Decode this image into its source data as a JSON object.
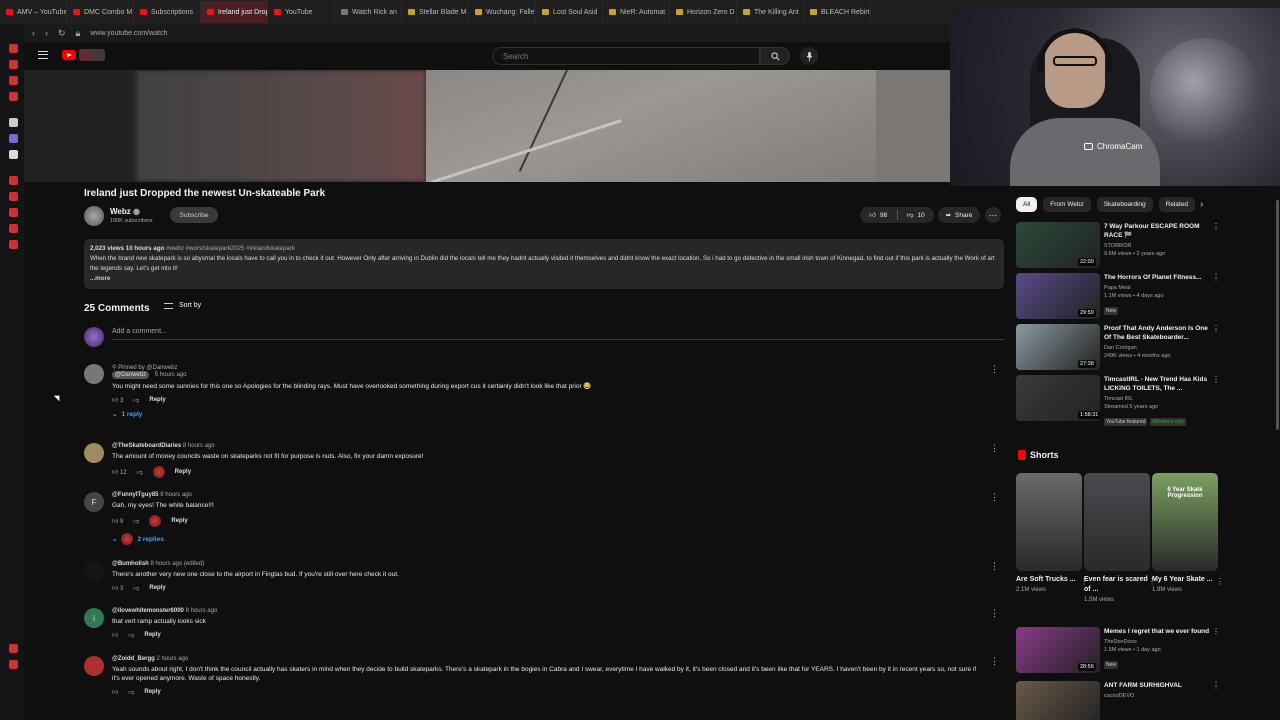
{
  "browser": {
    "tabs": [
      {
        "label": "AMV – YouTube",
        "fav": "red"
      },
      {
        "label": "DMC Combo M",
        "fav": "red"
      },
      {
        "label": "Subscriptions",
        "fav": "red"
      },
      {
        "label": "Ireland just Dropped",
        "fav": "red",
        "active": true
      },
      {
        "label": "YouTube",
        "fav": "red"
      },
      {
        "label": "Watch Rick an",
        "fav": "dark"
      },
      {
        "label": "Stellar Blade M",
        "fav": "gold"
      },
      {
        "label": "Wuchang: Falle",
        "fav": "gold"
      },
      {
        "label": "Lost Soul Asid",
        "fav": "gold"
      },
      {
        "label": "NieR: Automat",
        "fav": "gold"
      },
      {
        "label": "Horizon Zero D",
        "fav": "gold"
      },
      {
        "label": "The Killing Ant",
        "fav": "gold"
      },
      {
        "label": "BLEACH Rebirt",
        "fav": "gold"
      }
    ],
    "url": "www.youtube.com/watch"
  },
  "header": {
    "search_placeholder": "Search"
  },
  "webcam": {
    "label": "ChromaCam"
  },
  "video": {
    "title": "Ireland just Dropped the newest Un-skateable Park",
    "channel": "Webz",
    "subscribers": "190K subscribers",
    "subscribe_label": "Subscribe",
    "likes": "98",
    "dislikes": "10",
    "share_label": "Share",
    "description": {
      "meta": "2,023 views  10 hours ago",
      "tags": "#webz #worstskatepark2025 #irelandskatepark",
      "text": "When the brand new skatepark is so abysmal the locals have to call you in to check it out. However Only after arriving in Dublin did the locals tell me they hadnt actually visited it themselves and didnt know the exact location. So i had to go detective in the small irish town of Kinnegad, to find out if this park is actually the Work of art the legends say. Let's get into it!",
      "more": "...more"
    }
  },
  "comments": {
    "count_label": "25 Comments",
    "sort_label": "Sort by",
    "add_placeholder": "Add a comment...",
    "items": [
      {
        "pinned": "Pinned by @Danwebz",
        "author": "@Danwebz",
        "time": "5 hours ago",
        "text": "You might need some sunnies for this one so Apologies for the blinding rays. Must have overlooked something during export cus it certainly didn't look like that prior 😂",
        "likes": "3",
        "reply_label": "Reply",
        "replies": "1 reply",
        "avatar_color": "#777",
        "avatar_letter": ""
      },
      {
        "author": "@TheSkateboardDiaries",
        "time": "8 hours ago",
        "text": "The amount of money councils waste on skateparks not fit for purpose is nuts.  Also, fix your damn exposure!",
        "likes": "12",
        "reply_label": "Reply",
        "avatar_color": "#a08a60",
        "avatar_letter": ""
      },
      {
        "author": "@FunnyITguy85",
        "time": "8 hours ago",
        "text": "Gah, my eyes! The white balance!!!",
        "likes": "9",
        "reply_label": "Reply",
        "replies": "2 replies",
        "avatar_color": "#4a4545",
        "avatar_letter": "F"
      },
      {
        "author": "@Bumholish",
        "time": "8 hours ago (edited)",
        "text": "There's another very new one close to the airport in Finglas bud. If you're still over here check it out.",
        "likes": "3",
        "reply_label": "Reply",
        "avatar_color": "#151515",
        "avatar_letter": ""
      },
      {
        "author": "@ilovewhitemonster6000",
        "time": "8 hours ago",
        "text": "that vert ramp actually looks sick",
        "likes": "",
        "reply_label": "Reply",
        "avatar_color": "#2f7a55",
        "avatar_letter": "i"
      },
      {
        "author": "@Zoidd_Bergg",
        "time": "2 hours ago",
        "text": "Yeah sounds about right, I don't think the council actually has skaters in mind when they decide to build skateparks. There's a skatepark in the bogies in Cabra and I swear, everytime I have walked by it, it's been closed and it's been like that for YEARS. I haven't been by it in recent years so, not sure if it's ever opened anymore. Waste of space honestly.",
        "likes": "",
        "reply_label": "Reply",
        "avatar_color": "#b03030",
        "avatar_letter": ""
      }
    ]
  },
  "sidebar": {
    "chips": [
      "All",
      "From Webz",
      "Skateboarding",
      "Related"
    ],
    "recommended": [
      {
        "title": "7 Way Parkour ESCAPE ROOM RACE 🏁",
        "channel": "STORROR",
        "meta": "9.6M views • 2 years ago",
        "duration": "22:00",
        "color": "#2b4a3a",
        "badge": ""
      },
      {
        "title": "The Horrors Of Planet Fitness...",
        "channel": "Papa Meat",
        "meta": "1.1M views • 4 days ago",
        "duration": "29:59",
        "color": "#5a4a8a",
        "badge": "New"
      },
      {
        "title": "Proof That Andy Anderson Is One Of The Best Skateboarder...",
        "channel": "Dan Corrigan",
        "meta": "249K views • 4 months ago",
        "duration": "27:38",
        "color": "#8a9aa0",
        "badge": ""
      },
      {
        "title": "TimcastIRL - New Trend Has Kids LICKING TOILETS, The ...",
        "channel": "Timcast IRL",
        "meta": "Streamed 5 years ago",
        "duration": "1:58:31",
        "color": "#3a3a3a",
        "badge": "YouTube featured",
        "members": "Members only"
      }
    ],
    "shorts_label": "Shorts",
    "shorts": [
      {
        "title": "Are Soft Trucks ...",
        "views": "2.1M views",
        "color": "#6a6a6e"
      },
      {
        "title": "Even fear is scared of ...",
        "views": "1.5M views",
        "color": "#4a4a50"
      },
      {
        "title": "My 6 Year Skate ...",
        "views": "1.9M views",
        "color": "#7aa060",
        "overlay": "6 Year Skate Progression"
      }
    ],
    "more_recommended": [
      {
        "title": "Memes I regret that we ever found",
        "channel": "TheDooDooo",
        "meta": "1.5M views • 1 day ago",
        "duration": "28:56",
        "color": "#8a3a8a",
        "badge": "New"
      },
      {
        "title": "ANT FARM SURHIGHVAL",
        "channel": "cacooDEVO",
        "meta": "",
        "duration": "",
        "color": "#6a5a4a",
        "badge": ""
      }
    ]
  }
}
